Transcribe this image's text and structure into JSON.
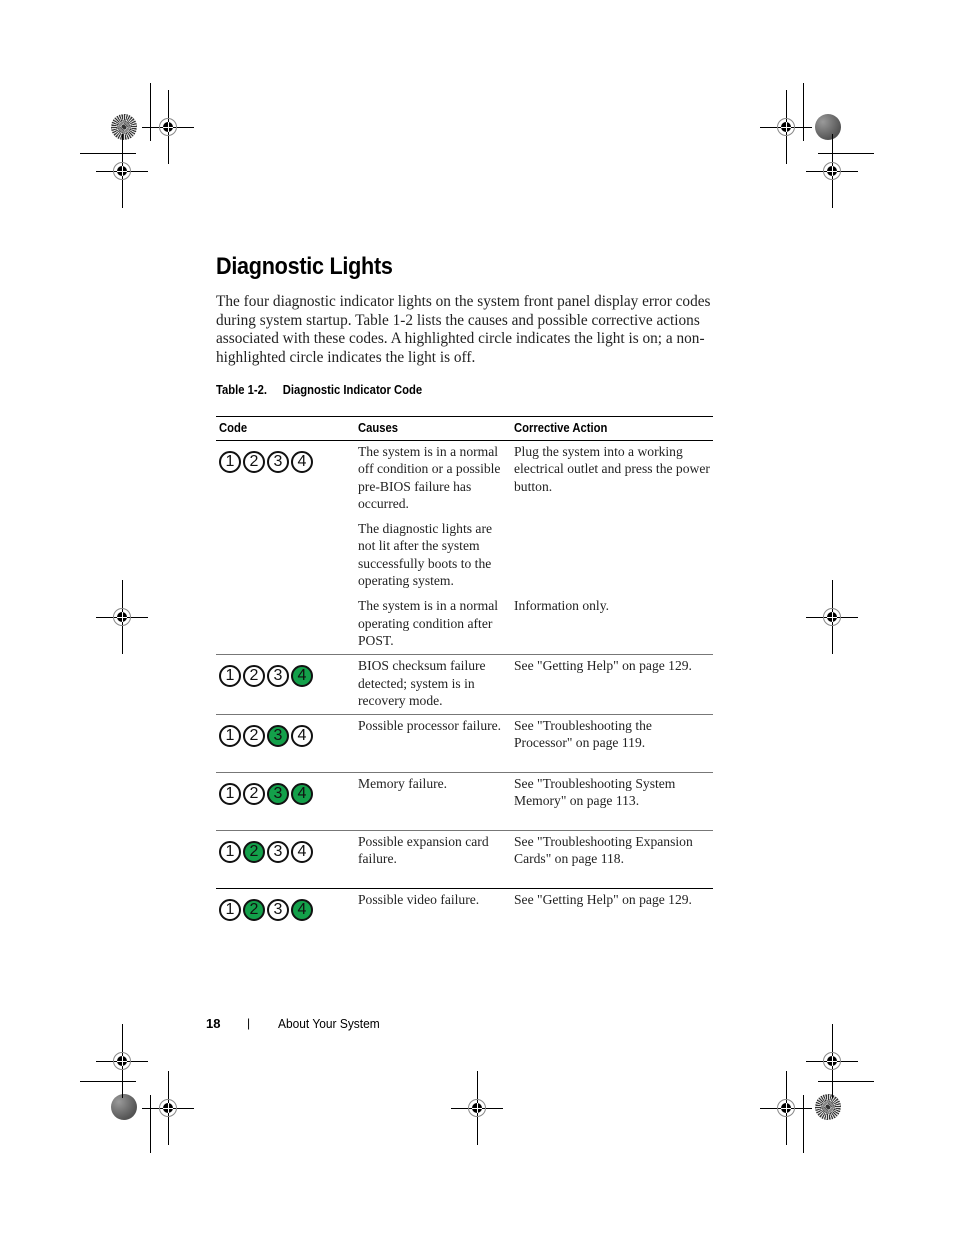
{
  "page": {
    "heading": "Diagnostic Lights",
    "intro": "The four diagnostic indicator lights on the system front panel display error codes during system startup. Table 1-2 lists the causes and possible corrective actions associated with these codes. A highlighted circle indicates the light is on; a non-highlighted circle indicates the light is off.",
    "table_caption_number": "Table 1-2.",
    "table_caption_title": "Diagnostic Indicator Code",
    "led_on_color": "#13a04a",
    "table": {
      "headers": [
        "Code",
        "Causes",
        "Corrective Action"
      ],
      "rows": [
        {
          "code": {
            "lights": [
              "1",
              "2",
              "3",
              "4"
            ],
            "on": [
              false,
              false,
              false,
              false
            ]
          },
          "entries": [
            {
              "cause": "The system is in a normal off condition or a possible pre-BIOS failure has occurred.",
              "action": "Plug the system into a working electrical outlet and press the power button."
            },
            {
              "cause": "The diagnostic lights are not lit after the system successfully boots to the operating system.",
              "action": ""
            },
            {
              "cause": "The system is in a normal operating condition after POST.",
              "action": "Information only."
            }
          ]
        },
        {
          "code": {
            "lights": [
              "1",
              "2",
              "3",
              "4"
            ],
            "on": [
              false,
              false,
              false,
              true
            ]
          },
          "entries": [
            {
              "cause": "BIOS checksum failure detected; system is in recovery mode.",
              "action": "See \"Getting Help\" on page 129."
            }
          ]
        },
        {
          "code": {
            "lights": [
              "1",
              "2",
              "3",
              "4"
            ],
            "on": [
              false,
              false,
              true,
              false
            ]
          },
          "entries": [
            {
              "cause": "Possible processor failure.",
              "action": "See \"Troubleshooting the Processor\" on page 119."
            }
          ]
        },
        {
          "code": {
            "lights": [
              "1",
              "2",
              "3",
              "4"
            ],
            "on": [
              false,
              false,
              true,
              true
            ]
          },
          "entries": [
            {
              "cause": "Memory failure.",
              "action": "See \"Troubleshooting System Memory\" on page 113."
            }
          ]
        },
        {
          "code": {
            "lights": [
              "1",
              "2",
              "3",
              "4"
            ],
            "on": [
              false,
              true,
              false,
              false
            ]
          },
          "entries": [
            {
              "cause": "Possible expansion card failure.",
              "action": "See \"Troubleshooting Expansion Cards\" on page 118."
            }
          ]
        },
        {
          "code": {
            "lights": [
              "1",
              "2",
              "3",
              "4"
            ],
            "on": [
              false,
              true,
              false,
              true
            ]
          },
          "entries": [
            {
              "cause": "Possible video failure.",
              "action": "See \"Getting Help\" on page 129."
            }
          ]
        }
      ]
    },
    "footer": {
      "page_number": "18",
      "separator": "|",
      "section_title": "About Your System"
    }
  }
}
